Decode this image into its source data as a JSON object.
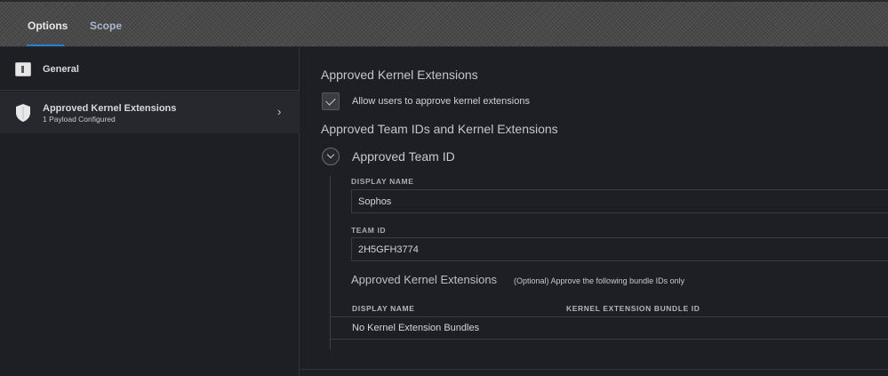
{
  "tabs": [
    {
      "label": "Options",
      "active": true
    },
    {
      "label": "Scope",
      "active": false
    }
  ],
  "sidebar": {
    "items": [
      {
        "label": "General",
        "icon": "document-icon"
      },
      {
        "label": "Approved Kernel Extensions",
        "sublabel": "1 Payload Configured",
        "icon": "shield-icon"
      }
    ]
  },
  "main": {
    "section_title": "Approved Kernel Extensions",
    "allow_users_label": "Allow users to approve kernel extensions",
    "allow_users_checked": true,
    "team_section_title": "Approved Team IDs and Kernel Extensions",
    "team": {
      "title": "Approved Team ID",
      "display_name_label": "DISPLAY NAME",
      "display_name_value": "Sophos",
      "team_id_label": "TEAM ID",
      "team_id_value": "2H5GFH3774",
      "kext_heading": "Approved Kernel Extensions",
      "kext_note": "(Optional) Approve the following bundle IDs only",
      "table": {
        "columns": [
          "DISPLAY NAME",
          "KERNEL EXTENSION BUNDLE ID"
        ],
        "empty_text": "No Kernel Extension Bundles"
      }
    }
  },
  "colors": {
    "accent": "#2e7bd6",
    "background": "#1e1f24",
    "selected_row": "#26282e"
  }
}
